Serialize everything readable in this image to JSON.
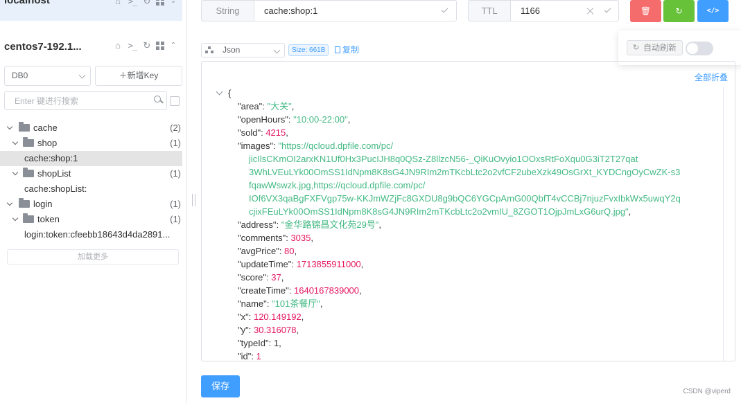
{
  "sidebar": {
    "connections": [
      {
        "name": "localhost"
      },
      {
        "name": "centos7-192.1..."
      }
    ],
    "db_select": "DB0",
    "new_key_label": "新增Key",
    "search_placeholder": "Enter 键进行搜索",
    "tree": [
      {
        "label": "cache",
        "count": "(2)",
        "kind": "folder",
        "depth": 0
      },
      {
        "label": "shop",
        "count": "(1)",
        "kind": "folder",
        "depth": 1
      },
      {
        "label": "cache:shop:1",
        "kind": "leaf",
        "depth": 2,
        "selected": true
      },
      {
        "label": "shopList",
        "count": "(1)",
        "kind": "folder",
        "depth": 1
      },
      {
        "label": "cache:shopList:",
        "kind": "leaf",
        "depth": 2
      },
      {
        "label": "login",
        "count": "(1)",
        "kind": "folder",
        "depth": 0
      },
      {
        "label": "token",
        "count": "(1)",
        "kind": "folder",
        "depth": 1
      },
      {
        "label": "login:token:cfeebb18643d4da2891...",
        "kind": "leaf",
        "depth": 2
      }
    ],
    "load_more": "加载更多"
  },
  "toolbar": {
    "type": "String",
    "key": "cache:shop:1",
    "ttl_label": "TTL",
    "ttl_value": "1166",
    "delete_icon": "trash-icon",
    "refresh_icon": "refresh-icon",
    "code_icon": "code-icon",
    "delete_color": "#f56c6c",
    "refresh_color": "#67c23a",
    "code_color": "#409eff"
  },
  "auto_refresh": {
    "label": "自动刷新",
    "enabled": false
  },
  "format": {
    "selected": "Json",
    "size": "Size: 661B",
    "copy": "复制"
  },
  "viewer": {
    "collapse_all": "全部折叠",
    "lines": [
      {
        "indent": 0,
        "k": "",
        "v": "{",
        "t": "p",
        "fold": true
      },
      {
        "indent": 1,
        "k": "\"area\"",
        "v": "\"大关\"",
        "t": "s",
        "c": ","
      },
      {
        "indent": 1,
        "k": "\"openHours\"",
        "v": "\"10:00-22:00\"",
        "t": "s",
        "c": ","
      },
      {
        "indent": 1,
        "k": "\"sold\"",
        "v": "4215",
        "t": "n",
        "c": ","
      },
      {
        "indent": 1,
        "k": "\"images\"",
        "v": "\"https://qcloud.dpfile.com/pc/",
        "t": "s",
        "c": ""
      },
      {
        "indent": 2,
        "k": "",
        "v": "jicIlsCKmOI2arxKN1Uf0Hx3PucIJH8q0QSz-Z8llzcN56-_QiKuOvyio1OOxsRtFoXqu0G3iT2T27qat",
        "t": "s",
        "c": ""
      },
      {
        "indent": 2,
        "k": "",
        "v": "3WhLVEuLYk00OmSS1IdNpm8K8sG4JN9RIm2mTKcbLtc2o2vfCF2ubeXzk49OsGrXt_KYDCngOyCwZK-s3",
        "t": "s",
        "c": ""
      },
      {
        "indent": 2,
        "k": "",
        "v": "fqawWswzk.jpg,https://qcloud.dpfile.com/pc/",
        "t": "s",
        "c": ""
      },
      {
        "indent": 2,
        "k": "",
        "v": "IOf6VX3qaBgFXFVgp75w-KKJmWZjFc8GXDU8g9bQC6YGCpAmG00QbfT4vCCBj7njuzFvxIbkWx5uwqY2q",
        "t": "s",
        "c": ""
      },
      {
        "indent": 2,
        "k": "",
        "v": "cjixFEuLYk00OmSS1IdNpm8K8sG4JN9RIm2mTKcbLtc2o2vmIU_8ZGOT1OjpJmLxG6urQ.jpg\"",
        "t": "s",
        "c": ","
      },
      {
        "indent": 1,
        "k": "\"address\"",
        "v": "\"金华路锦昌文化苑29号\"",
        "t": "s",
        "c": ","
      },
      {
        "indent": 1,
        "k": "\"comments\"",
        "v": "3035",
        "t": "n",
        "c": ","
      },
      {
        "indent": 1,
        "k": "\"avgPrice\"",
        "v": "80",
        "t": "n",
        "c": ","
      },
      {
        "indent": 1,
        "k": "\"updateTime\"",
        "v": "1713855911000",
        "t": "n",
        "c": ","
      },
      {
        "indent": 1,
        "k": "\"score\"",
        "v": "37",
        "t": "n",
        "c": ","
      },
      {
        "indent": 1,
        "k": "\"createTime\"",
        "v": "1640167839000",
        "t": "n",
        "c": ","
      },
      {
        "indent": 1,
        "k": "\"name\"",
        "v": "\"101茶餐厅\"",
        "t": "s",
        "c": ","
      },
      {
        "indent": 1,
        "k": "\"x\"",
        "v": "120.149192",
        "t": "n",
        "c": ","
      },
      {
        "indent": 1,
        "k": "\"y\"",
        "v": "30.316078",
        "t": "n",
        "c": ","
      },
      {
        "indent": 1,
        "k": "\"typeId\"",
        "v": "1",
        "t": "p",
        "c": ","
      },
      {
        "indent": 1,
        "k": "\"id\"",
        "v": "1",
        "t": "n",
        "c": ""
      }
    ]
  },
  "save_label": "保存",
  "watermark": "CSDN @viperd"
}
